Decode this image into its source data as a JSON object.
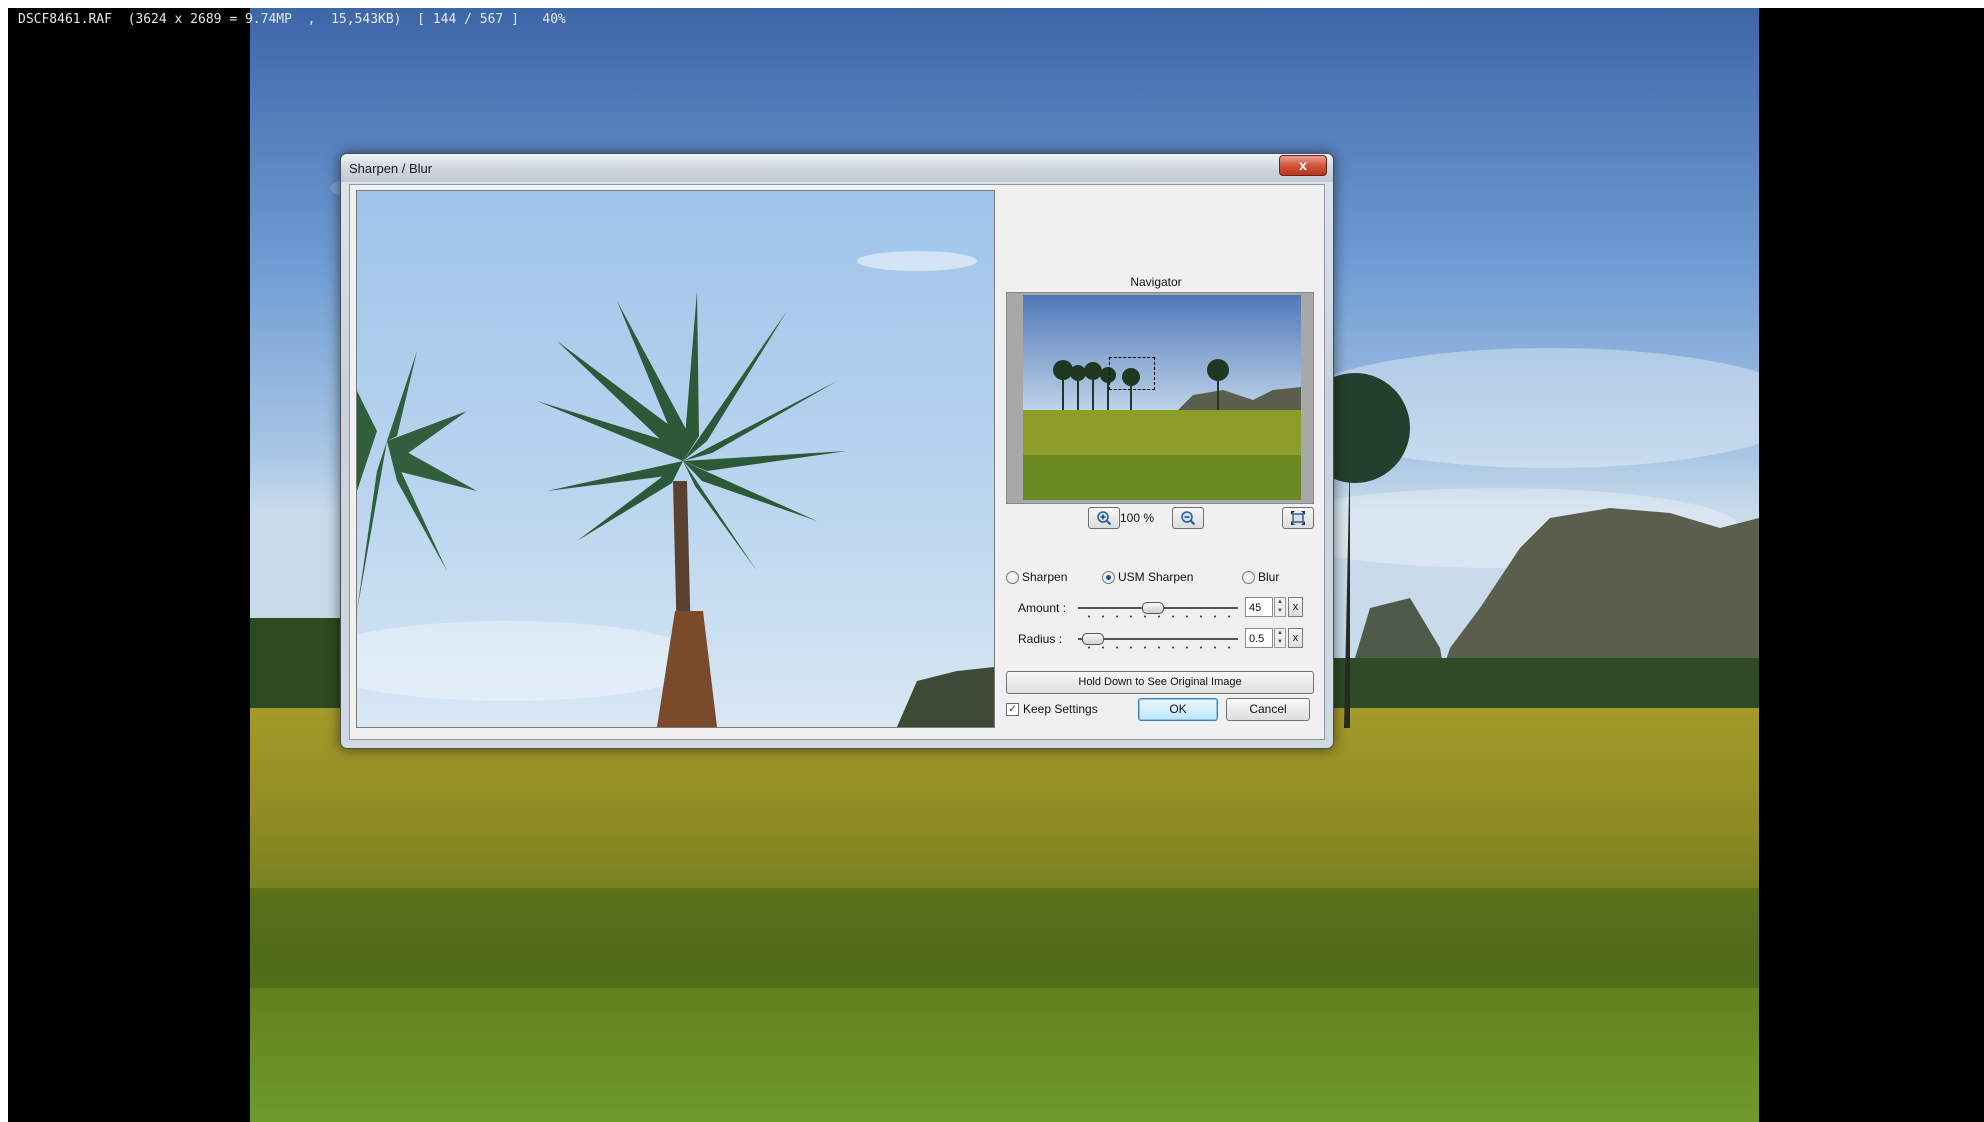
{
  "viewer": {
    "status_text": "DSCF8461.RAF  (3624 x 2689 = 9.74MP  ,  15,543KB)  [ 144 / 567 ]   40%"
  },
  "dialog": {
    "title": "Sharpen / Blur",
    "close_label": "x",
    "navigator_label": "Navigator",
    "zoom_level": "100 %",
    "modes": [
      {
        "label": "Sharpen",
        "selected": false
      },
      {
        "label": "USM Sharpen",
        "selected": true
      },
      {
        "label": "Blur",
        "selected": false
      }
    ],
    "amount": {
      "label": "Amount :",
      "value": "45",
      "reset_label": "x"
    },
    "radius": {
      "label": "Radius :",
      "value": "0.5",
      "reset_label": "x"
    },
    "hold_button_label": "Hold Down to See Original Image",
    "keep_settings_label": "Keep Settings",
    "keep_settings_checked": true,
    "ok_label": "OK",
    "cancel_label": "Cancel"
  },
  "icons": {
    "zoom_in": "zoom-in-icon",
    "zoom_out": "zoom-out-icon",
    "fit": "fit-to-window-icon",
    "close": "close-icon"
  },
  "colors": {
    "close_button": "#c8432a",
    "default_button": "#bee6fd",
    "viewer_background": "#000000"
  }
}
